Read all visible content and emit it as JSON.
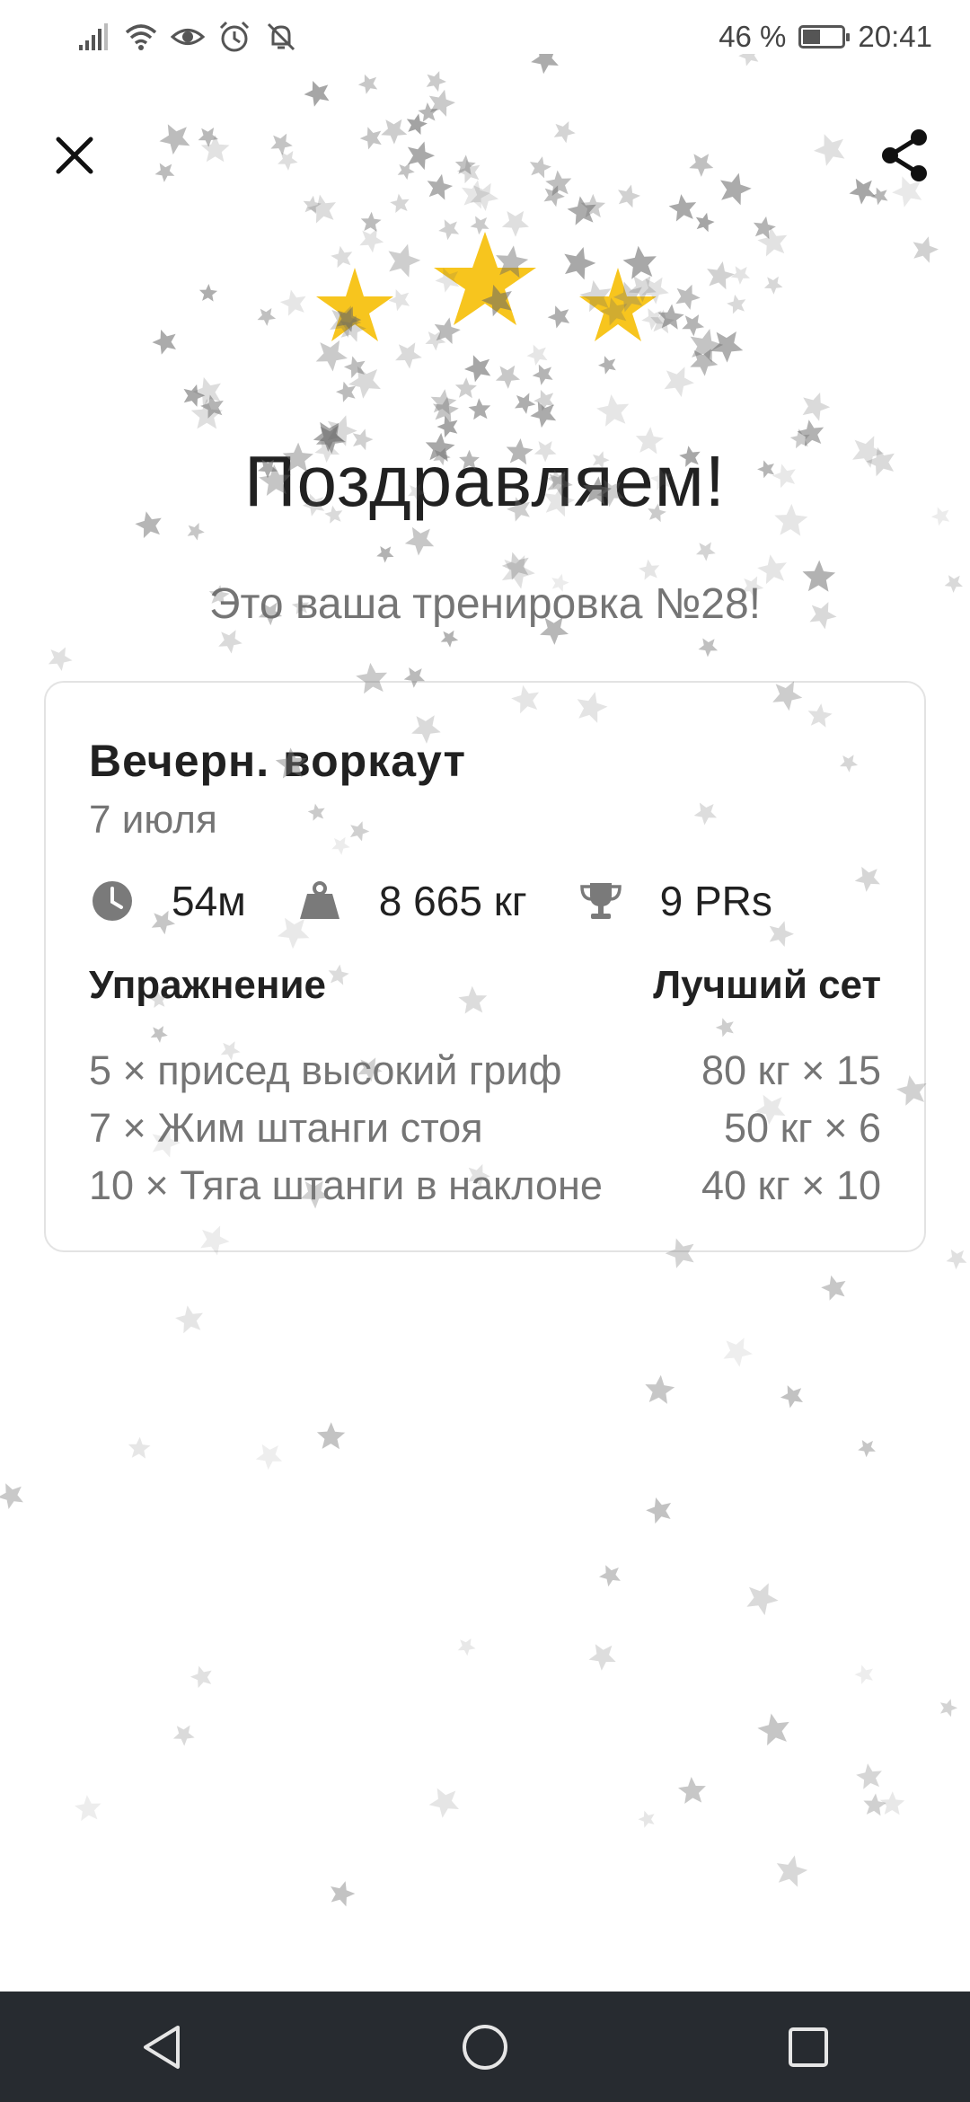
{
  "status_bar": {
    "battery": "46 %",
    "time": "20:41",
    "battery_level": 0.46,
    "icons": [
      "signal-icon",
      "wifi-icon",
      "eye-icon",
      "alarm-icon",
      "mute-icon"
    ]
  },
  "header": {
    "close_icon": "close-icon",
    "share_icon": "share-icon"
  },
  "congrats": {
    "title": "Поздравляем!",
    "subtitle": "Это ваша тренировка №28!",
    "star_color": "#F7C51E"
  },
  "workout": {
    "name": "Вечерн. воркаут",
    "date": "7 июля",
    "stats": {
      "duration": "54м",
      "volume": "8 665 кг",
      "prs": "9 PRs"
    },
    "table": {
      "col_exercise": "Упражнение",
      "col_best_set": "Лучший сет",
      "rows": [
        {
          "exercise": "5 × присед высокий гриф",
          "best_set": "80 кг × 15"
        },
        {
          "exercise": "7 × Жим штанги стоя",
          "best_set": "50 кг × 6"
        },
        {
          "exercise": "10 × Тяга штанги в наклоне",
          "best_set": "40 кг × 10"
        }
      ]
    }
  },
  "nav": {
    "back_icon": "back-triangle-icon",
    "home_icon": "home-circle-icon",
    "recents_icon": "recents-square-icon"
  },
  "colors": {
    "accent_star": "#F7C51E",
    "text_primary": "#212121",
    "text_secondary": "#757575",
    "navbar": "#272b30"
  }
}
